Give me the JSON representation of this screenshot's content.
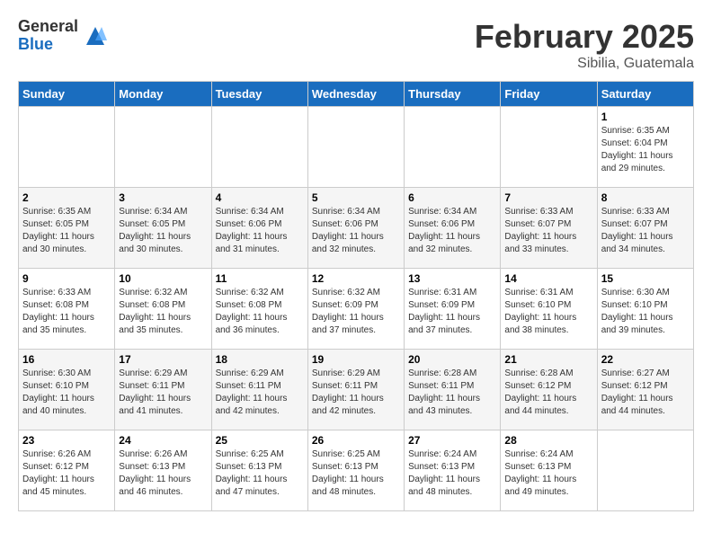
{
  "header": {
    "logo_general": "General",
    "logo_blue": "Blue",
    "month": "February 2025",
    "location": "Sibilia, Guatemala"
  },
  "days_of_week": [
    "Sunday",
    "Monday",
    "Tuesday",
    "Wednesday",
    "Thursday",
    "Friday",
    "Saturday"
  ],
  "weeks": [
    [
      {
        "day": "",
        "info": ""
      },
      {
        "day": "",
        "info": ""
      },
      {
        "day": "",
        "info": ""
      },
      {
        "day": "",
        "info": ""
      },
      {
        "day": "",
        "info": ""
      },
      {
        "day": "",
        "info": ""
      },
      {
        "day": "1",
        "info": "Sunrise: 6:35 AM\nSunset: 6:04 PM\nDaylight: 11 hours\nand 29 minutes."
      }
    ],
    [
      {
        "day": "2",
        "info": "Sunrise: 6:35 AM\nSunset: 6:05 PM\nDaylight: 11 hours\nand 30 minutes."
      },
      {
        "day": "3",
        "info": "Sunrise: 6:34 AM\nSunset: 6:05 PM\nDaylight: 11 hours\nand 30 minutes."
      },
      {
        "day": "4",
        "info": "Sunrise: 6:34 AM\nSunset: 6:06 PM\nDaylight: 11 hours\nand 31 minutes."
      },
      {
        "day": "5",
        "info": "Sunrise: 6:34 AM\nSunset: 6:06 PM\nDaylight: 11 hours\nand 32 minutes."
      },
      {
        "day": "6",
        "info": "Sunrise: 6:34 AM\nSunset: 6:06 PM\nDaylight: 11 hours\nand 32 minutes."
      },
      {
        "day": "7",
        "info": "Sunrise: 6:33 AM\nSunset: 6:07 PM\nDaylight: 11 hours\nand 33 minutes."
      },
      {
        "day": "8",
        "info": "Sunrise: 6:33 AM\nSunset: 6:07 PM\nDaylight: 11 hours\nand 34 minutes."
      }
    ],
    [
      {
        "day": "9",
        "info": "Sunrise: 6:33 AM\nSunset: 6:08 PM\nDaylight: 11 hours\nand 35 minutes."
      },
      {
        "day": "10",
        "info": "Sunrise: 6:32 AM\nSunset: 6:08 PM\nDaylight: 11 hours\nand 35 minutes."
      },
      {
        "day": "11",
        "info": "Sunrise: 6:32 AM\nSunset: 6:08 PM\nDaylight: 11 hours\nand 36 minutes."
      },
      {
        "day": "12",
        "info": "Sunrise: 6:32 AM\nSunset: 6:09 PM\nDaylight: 11 hours\nand 37 minutes."
      },
      {
        "day": "13",
        "info": "Sunrise: 6:31 AM\nSunset: 6:09 PM\nDaylight: 11 hours\nand 37 minutes."
      },
      {
        "day": "14",
        "info": "Sunrise: 6:31 AM\nSunset: 6:10 PM\nDaylight: 11 hours\nand 38 minutes."
      },
      {
        "day": "15",
        "info": "Sunrise: 6:30 AM\nSunset: 6:10 PM\nDaylight: 11 hours\nand 39 minutes."
      }
    ],
    [
      {
        "day": "16",
        "info": "Sunrise: 6:30 AM\nSunset: 6:10 PM\nDaylight: 11 hours\nand 40 minutes."
      },
      {
        "day": "17",
        "info": "Sunrise: 6:29 AM\nSunset: 6:11 PM\nDaylight: 11 hours\nand 41 minutes."
      },
      {
        "day": "18",
        "info": "Sunrise: 6:29 AM\nSunset: 6:11 PM\nDaylight: 11 hours\nand 42 minutes."
      },
      {
        "day": "19",
        "info": "Sunrise: 6:29 AM\nSunset: 6:11 PM\nDaylight: 11 hours\nand 42 minutes."
      },
      {
        "day": "20",
        "info": "Sunrise: 6:28 AM\nSunset: 6:11 PM\nDaylight: 11 hours\nand 43 minutes."
      },
      {
        "day": "21",
        "info": "Sunrise: 6:28 AM\nSunset: 6:12 PM\nDaylight: 11 hours\nand 44 minutes."
      },
      {
        "day": "22",
        "info": "Sunrise: 6:27 AM\nSunset: 6:12 PM\nDaylight: 11 hours\nand 44 minutes."
      }
    ],
    [
      {
        "day": "23",
        "info": "Sunrise: 6:26 AM\nSunset: 6:12 PM\nDaylight: 11 hours\nand 45 minutes."
      },
      {
        "day": "24",
        "info": "Sunrise: 6:26 AM\nSunset: 6:13 PM\nDaylight: 11 hours\nand 46 minutes."
      },
      {
        "day": "25",
        "info": "Sunrise: 6:25 AM\nSunset: 6:13 PM\nDaylight: 11 hours\nand 47 minutes."
      },
      {
        "day": "26",
        "info": "Sunrise: 6:25 AM\nSunset: 6:13 PM\nDaylight: 11 hours\nand 48 minutes."
      },
      {
        "day": "27",
        "info": "Sunrise: 6:24 AM\nSunset: 6:13 PM\nDaylight: 11 hours\nand 48 minutes."
      },
      {
        "day": "28",
        "info": "Sunrise: 6:24 AM\nSunset: 6:13 PM\nDaylight: 11 hours\nand 49 minutes."
      },
      {
        "day": "",
        "info": ""
      }
    ]
  ]
}
